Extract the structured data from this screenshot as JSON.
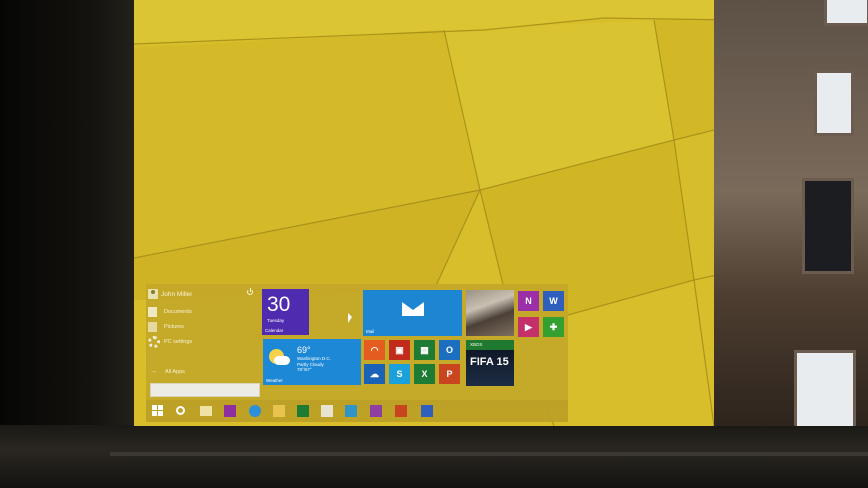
{
  "user": {
    "name": "John Miller"
  },
  "nav": [
    {
      "label": "Documents",
      "icon": "document-icon"
    },
    {
      "label": "Pictures",
      "icon": "pictures-icon"
    },
    {
      "label": "PC settings",
      "icon": "gear-icon"
    }
  ],
  "all_apps": {
    "label": "All Apps"
  },
  "tiles": {
    "calendar": {
      "date": "30",
      "day": "Tuesday",
      "label": "Calendar"
    },
    "mail": {
      "label": "Mail"
    },
    "weather": {
      "temp": "69°",
      "location": "Washington D.C.",
      "condition": "Partly Cloudy",
      "range": "78°/67°",
      "label": "Weather"
    },
    "xbox": {
      "label": "XBOX",
      "game": "FIFA 15"
    },
    "onenote": {
      "glyph": "N"
    },
    "word": {
      "glyph": "W"
    },
    "excel": {
      "glyph": "X"
    },
    "outlook": {
      "glyph": "O"
    },
    "powerpoint": {
      "glyph": "P"
    }
  },
  "taskbar": {
    "items": [
      "start",
      "search",
      "file-explorer",
      "onenote",
      "internet-explorer",
      "explorer",
      "excel",
      "acrobat",
      "photos",
      "store",
      "powerpoint",
      "word"
    ]
  },
  "colors": {
    "wallpaper": "#d7be2a",
    "accent": "#c4a828",
    "calendar": "#4f2bb0",
    "mail": "#1d86d3"
  }
}
